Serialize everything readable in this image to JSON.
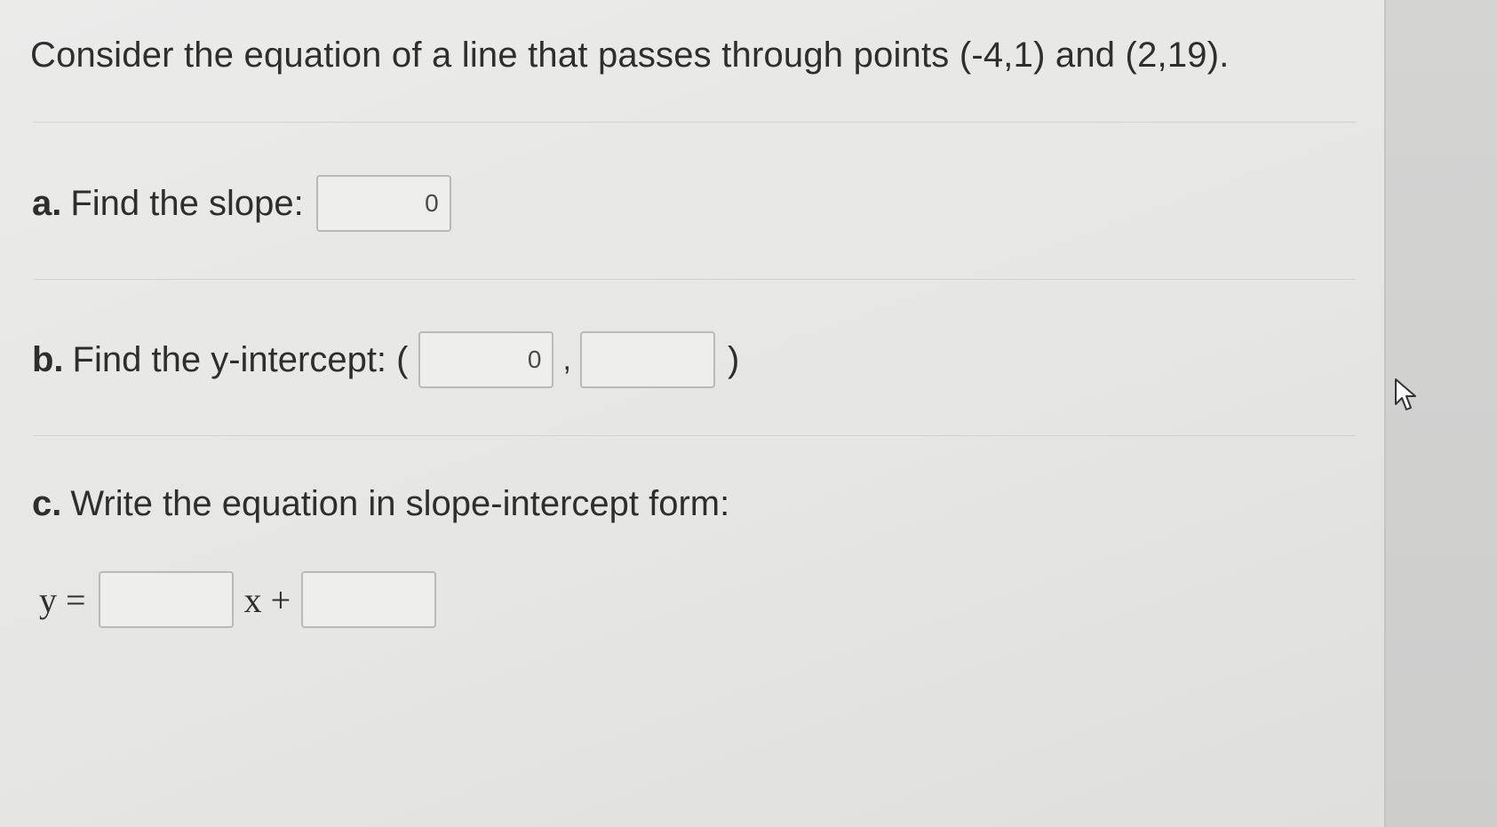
{
  "question": {
    "text": "Consider the equation of a line that passes through points (-4,1) and (2,19)."
  },
  "part_a": {
    "letter": "a.",
    "label": "Find the slope:",
    "slope_value": "0"
  },
  "part_b": {
    "letter": "b.",
    "label": "Find the y-intercept: (",
    "x_value": "0",
    "comma": ",",
    "y_value": "",
    "close_paren": ")"
  },
  "part_c": {
    "letter": "c.",
    "label": "Write the equation in slope-intercept form:",
    "y_equals": "y =",
    "x_plus": "x +",
    "m_value": "",
    "b_value": ""
  },
  "colors": {
    "background": "#e8e8e6",
    "text": "#2e2e2e",
    "box_border": "#b9b9b9",
    "cursor_fill": "#ffffff"
  },
  "icons": {
    "mouse_cursor": "arrow-pointer-icon"
  }
}
